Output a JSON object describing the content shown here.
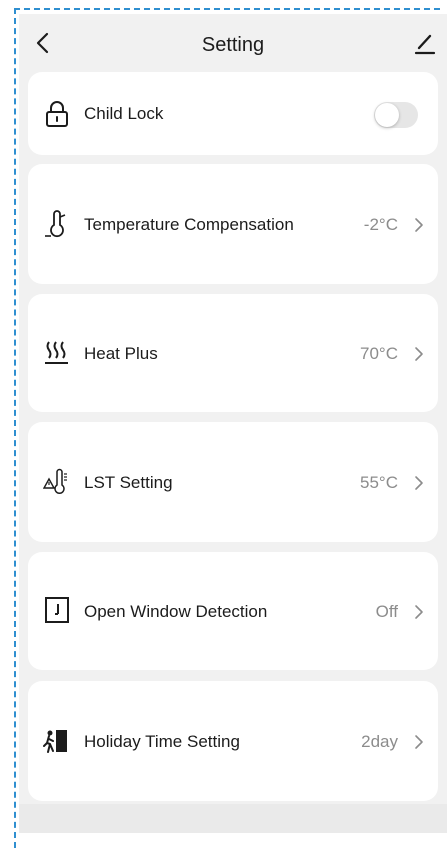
{
  "header": {
    "title": "Setting",
    "back_icon": "chevron-left-icon",
    "edit_icon": "pencil-icon"
  },
  "child_lock": {
    "label": "Child Lock",
    "icon": "lock-icon",
    "enabled": false
  },
  "settings": [
    {
      "label": "Temperature Compensation",
      "value": "-2°C",
      "icon": "thermometer-icon"
    },
    {
      "label": "Heat Plus",
      "value": "70°C",
      "icon": "heat-waves-icon"
    },
    {
      "label": "LST Setting",
      "value": "55°C",
      "icon": "warning-thermometer-icon"
    },
    {
      "label": "Open Window Detection",
      "value": "Off",
      "icon": "door-icon"
    },
    {
      "label": "Holiday Time Setting",
      "value": "2day",
      "icon": "person-exit-icon"
    }
  ],
  "colors": {
    "background": "#f1f1f1",
    "card": "#ffffff",
    "value_text": "#8c8c8c",
    "toggle_off": "#e6e6e6"
  }
}
